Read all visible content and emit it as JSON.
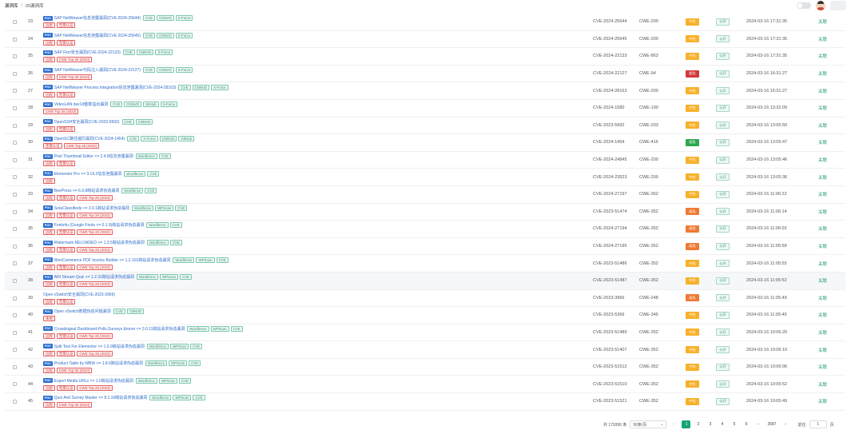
{
  "header": {
    "breadcrumb_root": "漏洞库",
    "breadcrumb_sep": "/",
    "breadcrumb_current": "09漏洞库"
  },
  "level_colors": {
    "中危": "#f7b12a",
    "高危": "#ee7a35",
    "超危": "#d4383b",
    "低危": "#2fa84f"
  },
  "rows": [
    {
      "no": "23",
      "title": "SAP NetWeaver信息泄露漏洞(CVE-2024-25644)",
      "tags": [
        "CVE",
        "CNNVD",
        "X-Force"
      ],
      "rtags": [
        "远程",
        "无需认证"
      ],
      "cve": "CVE-2024-25644",
      "cwe": "CWE-200",
      "level": "中危",
      "pub": "公开",
      "date": "2024-03-16 17:31:35",
      "act": "关联"
    },
    {
      "no": "24",
      "title": "SAP NetWeaver信息泄露漏洞(CVE-2024-25645)",
      "tags": [
        "CVE",
        "CNNVD",
        "X-Force"
      ],
      "rtags": [
        "远程",
        "无需认证"
      ],
      "cve": "CVE-2024-25645",
      "cwe": "CWE-200",
      "level": "中危",
      "pub": "公开",
      "date": "2024-03-16 17:31:35",
      "act": "关联"
    },
    {
      "no": "25",
      "title": "SAP Fiori安全漏洞(CVE-2024-22133)",
      "tags": [
        "CVE",
        "CNNVD",
        "X-Force"
      ],
      "rtags": [
        "远程",
        "CWE Top 25 (2023)"
      ],
      "cve": "CVE-2024-22133",
      "cwe": "CWE-863",
      "level": "中危",
      "pub": "公开",
      "date": "2024-03-16 17:31:35",
      "act": "关联"
    },
    {
      "no": "26",
      "title": "SAP NetWeaver代码注入漏洞(CVE-2024-22127)",
      "tags": [
        "CVE",
        "CNNVD",
        "X-Force"
      ],
      "rtags": [
        "远程",
        "CWE Top 25 (2023)"
      ],
      "cve": "CVE-2024-22127",
      "cwe": "CWE-94",
      "level": "超危",
      "pub": "公开",
      "date": "2024-03-16 16:31:27",
      "act": "关联"
    },
    {
      "no": "27",
      "title": "SAP NetWeaver Process Integration信息泄露漏洞(CVE-2024-28163)",
      "tags": [
        "CVE",
        "CNNVD",
        "X-Force"
      ],
      "rtags": [
        "远程",
        "无需认证"
      ],
      "cve": "CVE-2024-28163",
      "cwe": "CWE-200",
      "level": "中危",
      "pub": "公开",
      "date": "2024-03-16 16:31:27",
      "act": "关联"
    },
    {
      "no": "28",
      "title": "VideoLAN dav1d整数溢出漏洞",
      "tags": [
        "CVE",
        "CNNVD",
        "GitHub",
        "X-Force"
      ],
      "rtags": [
        "CWE Top 25 (2023)"
      ],
      "cve": "CVE-2024-1580",
      "cwe": "CWE-190",
      "level": "中危",
      "pub": "公开",
      "date": "2024-03-16 13:32:09",
      "act": "关联"
    },
    {
      "no": "29",
      "title": "OpenSSH安全漏洞(CVE-2023-5992)",
      "tags": [
        "CVE",
        "CNNVD"
      ],
      "rtags": [
        "远程",
        "无需认证"
      ],
      "cve": "CVE-2023-5992",
      "cwe": "CWE-203",
      "level": "中危",
      "pub": "公开",
      "date": "2024-03-16 13:05:50",
      "act": "关联"
    },
    {
      "no": "30",
      "title": "OpenSC路径遍历漏洞(CVE-2024-1454)",
      "tags": [
        "CVE",
        "X-Force",
        "CNNVD",
        "GitHub"
      ],
      "rtags": [
        "无需认证",
        "CWE Top 25 (2023)"
      ],
      "cve": "CVE-2024-1454",
      "cwe": "CWE-416",
      "level": "低危",
      "pub": "公开",
      "date": "2024-03-16 13:05:47",
      "act": "关联"
    },
    {
      "no": "31",
      "title": "Post Thumbnail Editor <= 2.4.8信息泄露漏洞",
      "tags": [
        "Wordfence",
        "CVE"
      ],
      "rtags": [
        "远程",
        "无需认证"
      ],
      "cve": "CVE-2024-24845",
      "cwe": "CWE-200",
      "level": "中危",
      "pub": "公开",
      "date": "2024-03-16 13:05:46",
      "act": "关联"
    },
    {
      "no": "32",
      "title": "Elementor Pro <= 3.19.2信息泄露漏洞",
      "tags": [
        "Wordfence",
        "CVE"
      ],
      "rtags": [
        "远程"
      ],
      "cve": "CVE-2024-23523",
      "cwe": "CWE-200",
      "level": "中危",
      "pub": "公开",
      "date": "2024-03-16 13:05:36",
      "act": "关联"
    },
    {
      "no": "33",
      "title": "BeePress <= 6.9.8跨站请求伪造漏洞",
      "tags": [
        "Wordfence",
        "CVE"
      ],
      "rtags": [
        "远程",
        "无需认证",
        "CWE Top 25 (2023)"
      ],
      "cve": "CVE-2024-27197",
      "cwe": "CWE-352",
      "level": "中危",
      "pub": "公开",
      "date": "2024-03-16 11:06:22",
      "act": "关联"
    },
    {
      "no": "34",
      "title": "SetaClassifieds <= 2.0.1跨站请求伪造漏洞",
      "tags": [
        "Wordfence",
        "WPScan",
        "CVE"
      ],
      "rtags": [
        "远程",
        "无需认证",
        "CWE Top 25 (2023)"
      ],
      "cve": "CVE-2023-51474",
      "cwe": "CWE-352",
      "level": "高危",
      "pub": "公开",
      "date": "2024-03-16 11:06:14",
      "act": "关联"
    },
    {
      "no": "35",
      "title": "Fonts4u (Google Fonts <= 0.1.9)跨站请求伪造漏洞",
      "tags": [
        "Wordfence",
        "CVE"
      ],
      "rtags": [
        "远程",
        "无需认证",
        "CWE Top 25 (2023)"
      ],
      "cve": "CVE-2024-27194",
      "cwe": "CWE-352",
      "level": "高危",
      "pub": "公开",
      "date": "2024-03-16 11:06:02",
      "act": "关联"
    },
    {
      "no": "36",
      "title": "Watermark RELOADED <= 1.3.5跨站请求伪造漏洞",
      "tags": [
        "Wordfence",
        "CVE"
      ],
      "rtags": [
        "远程",
        "无需认证",
        "CWE Top 25 (2023)"
      ],
      "cve": "CVE-2024-27195",
      "cwe": "CWE-352",
      "level": "高危",
      "pub": "公开",
      "date": "2024-03-16 11:05:58",
      "act": "关联"
    },
    {
      "no": "37",
      "title": "WooCommerce PDF Invoice Builder <= 1.2.101跨站请求伪造漏洞",
      "tags": [
        "Wordfence",
        "WPScan",
        "CVE"
      ],
      "rtags": [
        "远程",
        "无需认证",
        "CWE Top 25 (2023)"
      ],
      "cve": "CVE-2023-51486",
      "cwe": "CWE-352",
      "level": "中危",
      "pub": "公开",
      "date": "2024-03-16 11:05:55",
      "act": "关联"
    },
    {
      "no": "38",
      "title": "ARI Stream Quiz <= 1.2.32跨站请求伪造漏洞",
      "tags": [
        "Wordfence",
        "WPScan",
        "CVE"
      ],
      "rtags": [
        "远程",
        "无需认证",
        "CWE Top 25 (2023)"
      ],
      "cve": "CVE-2023-51487",
      "cwe": "CWE-352",
      "level": "中危",
      "pub": "公开",
      "date": "2024-03-16 11:05:52",
      "act": "关联",
      "hl": true
    },
    {
      "no": "39",
      "title": "Open vSwitch安全漏洞(CVE-2023-3966)",
      "tags": [],
      "rtags": [
        "远程",
        "无需认证"
      ],
      "cve": "CVE-2023-3966",
      "cwe": "CWE-248",
      "level": "高危",
      "pub": "公开",
      "date": "2024-03-16 11:05:49",
      "act": "关联",
      "nopoc": true
    },
    {
      "no": "40",
      "title": "Open vSwitch数据伪造问题漏洞",
      "tags": [
        "CVE",
        "CNNVD"
      ],
      "rtags": [
        "本地"
      ],
      "cve": "CVE-2023-5366",
      "cwe": "CWE-345",
      "level": "中危",
      "pub": "公开",
      "date": "2024-03-16 11:05:45",
      "act": "关联"
    },
    {
      "no": "41",
      "title": "Crowdsignal Dashboard-Polls,Surveys &more <= 3.0.11跨站请求伪造漏洞",
      "tags": [
        "Wordfence",
        "WPScan",
        "CVE"
      ],
      "rtags": [
        "远程",
        "无需认证",
        "CWE Top 25 (2023)"
      ],
      "cve": "CVE-2023-51489",
      "cwe": "CWE-352",
      "level": "中危",
      "pub": "公开",
      "date": "2024-03-16 10:06:20",
      "act": "关联"
    },
    {
      "no": "42",
      "title": "Split Test For Elementor <= 1.6.9跨站请求伪造漏洞",
      "tags": [
        "Wordfence",
        "WPScan",
        "CVE"
      ],
      "rtags": [
        "远程",
        "无需认证",
        "CWE Top 25 (2023)"
      ],
      "cve": "CVE-2023-51407",
      "cwe": "CWE-352",
      "level": "中危",
      "pub": "公开",
      "date": "2024-03-16 10:06:10",
      "act": "关联"
    },
    {
      "no": "43",
      "title": "Product Table by WBW <= 1.8.6跨站请求伪造漏洞",
      "tags": [
        "Wordfence",
        "WPScan",
        "CVE"
      ],
      "rtags": [
        "远程",
        "CWE Top 25 (2023)"
      ],
      "cve": "CVE-2023-51512",
      "cwe": "CWE-352",
      "level": "中危",
      "pub": "公开",
      "date": "2024-03-16 10:06:06",
      "act": "关联"
    },
    {
      "no": "44",
      "title": "Export Media URLs <= 1.0跨站请求伪造漏洞",
      "tags": [
        "Wordfence",
        "WPScan",
        "CVE"
      ],
      "rtags": [
        "远程",
        "无需认证",
        "CWE Top 25 (2023)"
      ],
      "cve": "CVE-2023-51510",
      "cwe": "CWE-352",
      "level": "中危",
      "pub": "公开",
      "date": "2024-03-16 10:05:52",
      "act": "关联"
    },
    {
      "no": "45",
      "title": "Quiz And Survey Master <= 8.1.16跨站请求伪造漏洞",
      "tags": [
        "Wordfence",
        "WPScan",
        "CVE"
      ],
      "rtags": [
        "远程",
        "CWE Top 25 (2023)"
      ],
      "cve": "CVE-2023-51521",
      "cwe": "CWE-352",
      "level": "中危",
      "pub": "公开",
      "date": "2024-03-16 10:05:49",
      "act": "关联"
    }
  ],
  "pagination": {
    "total": "共 179306 条",
    "page_size": "50条/页",
    "pages": [
      "1",
      "2",
      "3",
      "4",
      "5",
      "6"
    ],
    "active_page": "1",
    "ellipsis": "···",
    "last_page": "3587",
    "goto_label": "前往",
    "goto_value": "1",
    "goto_suffix": "页"
  }
}
